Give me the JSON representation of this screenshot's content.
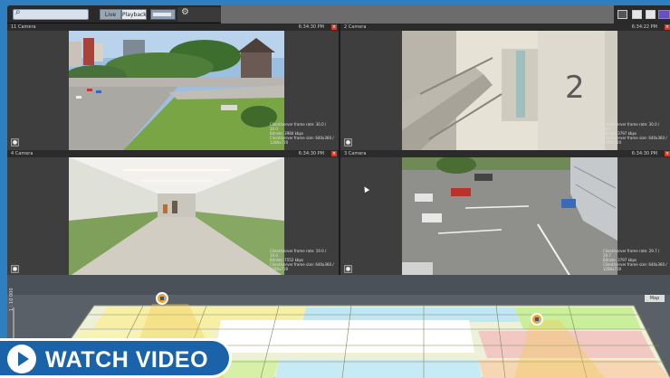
{
  "toolbar": {
    "search_icon": "search-icon",
    "mode_live_label": "Live",
    "mode_playback_label": "Playback"
  },
  "cameras": [
    {
      "name": "11 Camera",
      "time": "6:34:30 PM",
      "overlay": [
        "Client/server frame rate: 30.0 / 30.0",
        "Bitrate: 3984 kbps",
        "Client/server frame size: 640x360 / 1280x720"
      ]
    },
    {
      "name": "2 Camera",
      "time": "6:34:22 PM",
      "overlay": [
        "Client/server frame rate: 30.0 / 30.0",
        "Bitrate: 3797 kbps",
        "Client/server frame size: 640x360 / 1280x720"
      ]
    },
    {
      "name": "4 Camera",
      "time": "6:34:30 PM",
      "overlay": [
        "Client/server frame rate: 19.0 / 19.0",
        "Bitrate: 7552 kbps",
        "Client/server frame size: 640x360 / 1280x720"
      ]
    },
    {
      "name": "3 Camera",
      "time": "6:34:30 PM",
      "overlay": [
        "Client/server frame rate: 29.7 / 29.7",
        "Bitrate: 3797 kbps",
        "Client/server frame size: 640x360 / 1280x720"
      ]
    }
  ],
  "map": {
    "button_label": "Map",
    "zoom_label": "1 : 10 000"
  },
  "cta": {
    "label": "WATCH VIDEO"
  }
}
